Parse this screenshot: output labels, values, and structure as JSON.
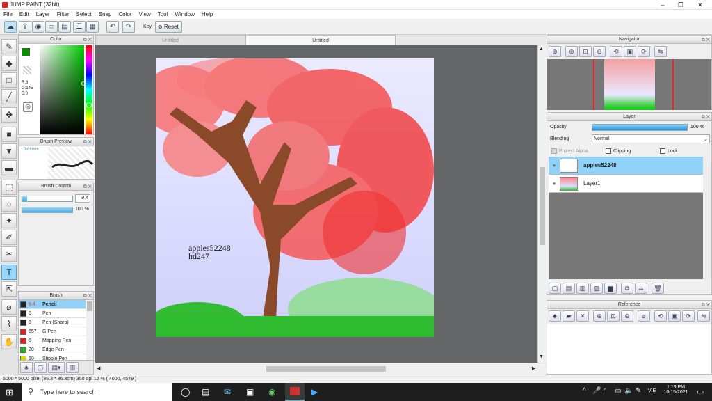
{
  "window": {
    "title": "JUMP PAINT (32bit)",
    "min": "–",
    "max": "❐",
    "close": "✕"
  },
  "menu": [
    "File",
    "Edit",
    "Layer",
    "Filter",
    "Select",
    "Snap",
    "Color",
    "View",
    "Tool",
    "Window",
    "Help"
  ],
  "toolbar": {
    "key_label": "Key",
    "reset_label": "Reset"
  },
  "tabs": [
    "Untitled",
    "Untitled"
  ],
  "color_panel": {
    "title": "Color",
    "r": "R:8",
    "g": "G:145",
    "b": "B:0",
    "fg": "#088f00",
    "bg": "#ffffff"
  },
  "brush_preview": {
    "title": "Brush Preview",
    "size": "* 0.68mm"
  },
  "brush_control": {
    "title": "Brush Control",
    "size_value": "9.4",
    "opacity_value": "100 %",
    "size_fraction": 0.1,
    "opacity_fraction": 1.0
  },
  "brush_panel": {
    "title": "Brush",
    "items": [
      {
        "color": "#222222",
        "size": "9.4",
        "name": "Pencil",
        "selected": true
      },
      {
        "color": "#222222",
        "size": "8",
        "name": "Pen",
        "selected": false
      },
      {
        "color": "#222222",
        "size": "8",
        "name": "Pen (Sharp)",
        "selected": false
      },
      {
        "color": "#e02020",
        "size": "657",
        "name": "G Pen",
        "selected": false
      },
      {
        "color": "#e02020",
        "size": "8",
        "name": "Mapping Pen",
        "selected": false
      },
      {
        "color": "#22aa22",
        "size": "20",
        "name": "Edge Pen",
        "selected": false
      },
      {
        "color": "#dddd00",
        "size": "50",
        "name": "Stipple Pen",
        "selected": false
      }
    ]
  },
  "canvas_text": {
    "line1": "apples52248",
    "line2": "hd247"
  },
  "navigator": {
    "title": "Navigator"
  },
  "layer_panel": {
    "title": "Layer",
    "opacity_label": "Opacity",
    "opacity_value": "100 %",
    "opacity_fraction": 1.0,
    "blending_label": "Blending",
    "blending_value": "Normal",
    "protect_alpha": "Protect Alpha",
    "clipping": "Clipping",
    "lock": "Lock",
    "layers": [
      {
        "name": "apples52248",
        "selected": true
      },
      {
        "name": "Layer1",
        "selected": false
      }
    ]
  },
  "reference": {
    "title": "Reference"
  },
  "status": "5000 * 5000 pixel  (36.3 * 36.3cm)  350 dpi  12 %  ( 4000, 4549 )",
  "taskbar": {
    "search_placeholder": "Type here to search",
    "lang": "VIE",
    "time": "1:13 PM",
    "date": "10/15/2021"
  },
  "icons": {
    "pencil": "pencil-icon",
    "eraser": "eraser-icon",
    "rect": "rectangle-icon",
    "line": "line-icon",
    "move": "move-icon",
    "fill_rect": "filled-rect-icon",
    "bucket": "bucket-icon",
    "gradient": "gradient-icon",
    "select_rect": "select-rect-icon",
    "lasso": "lasso-icon",
    "wand": "magic-wand-icon",
    "select_pen": "select-pen-icon",
    "select_eraser": "select-eraser-icon",
    "text": "text-icon",
    "pick": "picker-icon",
    "eyedropper": "eyedropper-icon",
    "spoid": "spoid-icon",
    "hand": "hand-icon"
  }
}
